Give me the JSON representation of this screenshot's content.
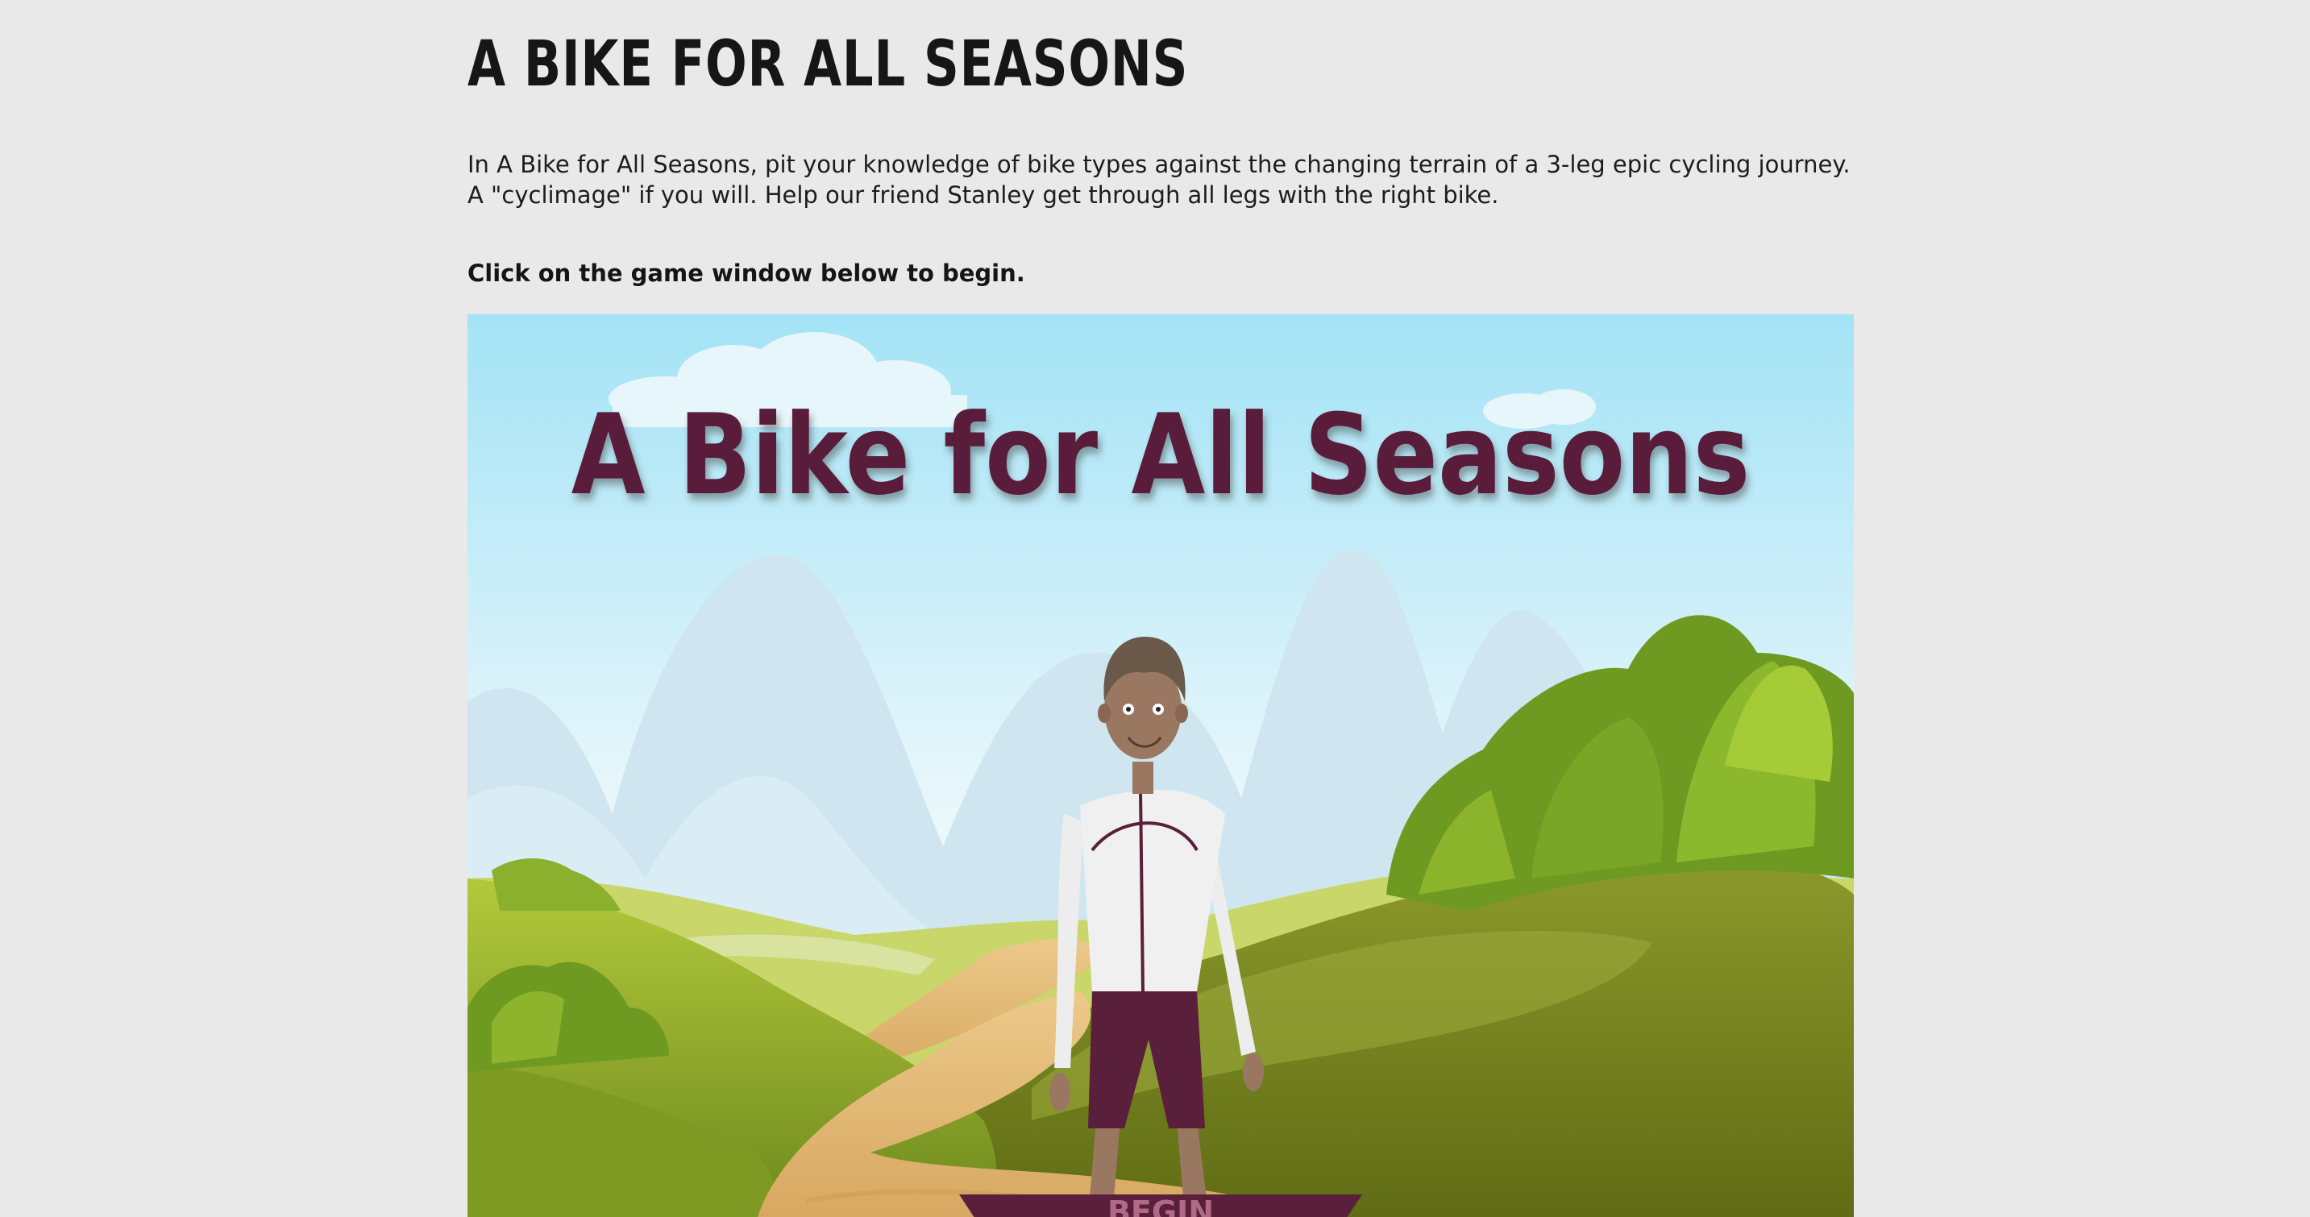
{
  "page": {
    "title": "A BIKE FOR ALL SEASONS",
    "intro": "In A Bike for All Seasons, pit your knowledge of bike types against the changing terrain of a 3-leg epic cycling journey. A \"cyclimage\" if you will. Help our friend Stanley get through all legs with the right bike.",
    "cta": "Click on the game window below to begin."
  },
  "game": {
    "logo_text": "A Bike for All Seasons",
    "begin_label": "BEGIN",
    "character": "Stanley",
    "colors": {
      "sky_top": "#a6e3f5",
      "sky_bottom": "#f4fbfd",
      "title_maroon": "#5a1f3b",
      "grass_light": "#b8cf3a",
      "grass_dark": "#6b8a1c",
      "path": "#e0b36a"
    }
  }
}
